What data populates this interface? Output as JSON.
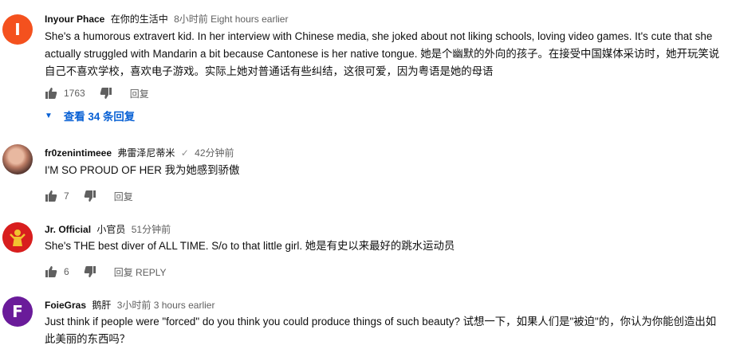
{
  "comments": [
    {
      "avatar_letter": "I",
      "author": "Inyour Phace",
      "author_cn": "在你的生活中",
      "time": "8小时前 Eight hours earlier",
      "text": "She's a humorous extravert kid.  In her interview with Chinese media, she joked about not liking schools, loving video games.  It's cute that she actually struggled with Mandarin a bit because Cantonese is her native tongue. 她是个幽默的外向的孩子。在接受中国媒体采访时，她开玩笑说自己不喜欢学校，喜欢电子游戏。实际上她对普通话有些纠结，这很可爱，因为粤语是她的母语",
      "likes": "1763",
      "reply_label": "回复",
      "view_replies": "查看 34 条回复"
    },
    {
      "author": "fr0zenintimeee",
      "author_cn": "弗雷泽尼蒂米",
      "verified": "✓",
      "time": "42分钟前",
      "text": "I'M SO PROUD OF HER 我为她感到骄傲",
      "likes": "7",
      "reply_label": "回复"
    },
    {
      "author": "Jr. Official",
      "author_cn": "小官员",
      "time": "51分钟前",
      "text": "She's THE best diver of ALL TIME. S/o to that little girl. 她是有史以来最好的跳水运动员",
      "likes": "6",
      "reply_label": "回复 REPLY"
    },
    {
      "avatar_letter": "F",
      "author": "FoieGras",
      "author_cn": "鹅肝",
      "time": "3小时前 3 hours earlier",
      "text": "Just think if people were \"forced\" do you think you could produce things of such beauty? 试想一下，如果人们是\"被迫\"的，你认为你能创造出如此美丽的东西吗？"
    }
  ],
  "colors": {
    "link_blue": "#065fd4",
    "meta_gray": "#606060",
    "avatar_orange": "#f4511e",
    "avatar_purple": "#6a1b9a"
  }
}
